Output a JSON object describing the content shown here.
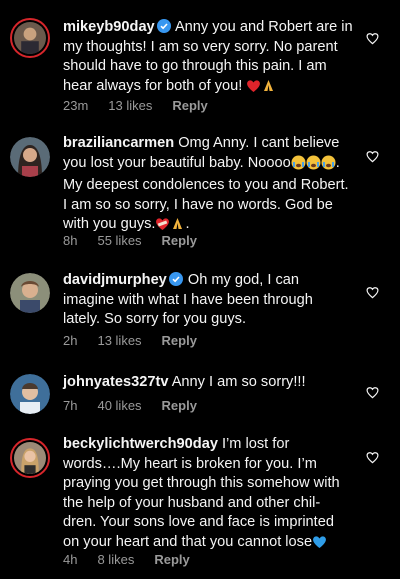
{
  "comments": [
    {
      "username": "mikeyb90day",
      "verified": true,
      "text": "Anny you and Robert are in my thoughts! I am so very sorry. No parent should have to go through this pain. I am hear always for both of you!",
      "emojis": [
        "red-heart",
        "folded-hands"
      ],
      "time": "23m",
      "likes": "13 likes",
      "reply": "Reply"
    },
    {
      "username": "braziliancarmen",
      "verified": false,
      "text": "Omg Anny. I cant believe you lost your beautiful baby. Noooo",
      "text2": ". My deepest condolences to you and Robert. I am so so sorry, I have no words. God be with you guys.",
      "time": "8h",
      "likes": "55 likes",
      "reply": "Reply"
    },
    {
      "username": "davidjmurphey",
      "verified": true,
      "text": "Oh my god,  I can imagine with what I have been through lately. So sorry for you guys.",
      "time": "2h",
      "likes": "13 likes",
      "reply": "Reply"
    },
    {
      "username": "johnyates327tv",
      "verified": false,
      "text": "Anny I am so sorry!!!",
      "time": "7h",
      "likes": "40 likes",
      "reply": "Reply"
    },
    {
      "username": "beckylichtwerch90day",
      "verified": false,
      "text": "I’m lost for words….My heart is broken for you. I’m praying you get through this somehow with the help of your husband and other chil-dren. Your sons love and face is imprinted on your heart and that you cannot lose",
      "time": "4h",
      "likes": "8 likes",
      "reply": "Reply"
    }
  ],
  "colors": {
    "background": "#000000",
    "text": "#f5f5f5",
    "meta": "#9a9a9a",
    "verified": "#3897f0",
    "story_ring": "#d6262b"
  }
}
